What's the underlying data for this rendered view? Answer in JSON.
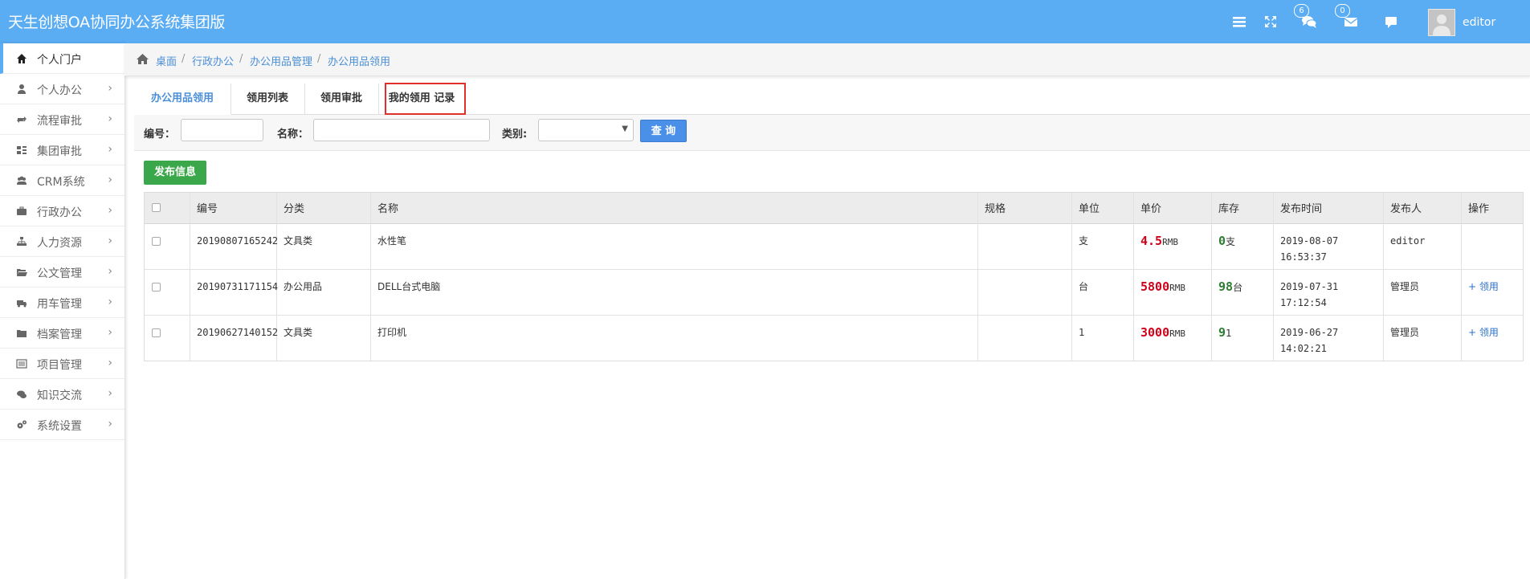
{
  "app": {
    "title": "天生创想OA协同办公系统集团版"
  },
  "topbar": {
    "icons": [
      "menu-icon",
      "fullscreen-icon",
      "chat-icon",
      "mail-icon",
      "comment-icon"
    ],
    "chat_badge": "6",
    "mail_badge": "0",
    "user_name": "editor"
  },
  "sidebar": {
    "items": [
      {
        "label": "个人门户",
        "icon": "home-icon"
      },
      {
        "label": "个人办公",
        "icon": "user-icon"
      },
      {
        "label": "流程审批",
        "icon": "workflow-icon"
      },
      {
        "label": "集团审批",
        "icon": "grid-icon"
      },
      {
        "label": "CRM系统",
        "icon": "users-icon"
      },
      {
        "label": "行政办公",
        "icon": "briefcase-icon"
      },
      {
        "label": "人力资源",
        "icon": "org-chart-icon"
      },
      {
        "label": "公文管理",
        "icon": "folder-open-icon"
      },
      {
        "label": "用车管理",
        "icon": "truck-icon"
      },
      {
        "label": "档案管理",
        "icon": "folder-icon"
      },
      {
        "label": "项目管理",
        "icon": "list-icon"
      },
      {
        "label": "知识交流",
        "icon": "comments-icon"
      },
      {
        "label": "系统设置",
        "icon": "cogs-icon"
      }
    ],
    "arrow": "›"
  },
  "breadcrumb": [
    "桌面",
    "行政办公",
    "办公用品管理",
    "办公用品领用"
  ],
  "tabs": [
    "办公用品领用",
    "领用列表",
    "领用审批",
    "我的领用 记录"
  ],
  "filters": {
    "code_label": "编号：",
    "name_label": "名称：",
    "category_label": "类别:",
    "query_button": "查 询"
  },
  "publish_button": "发布信息",
  "table": {
    "headers": [
      "编号",
      "分类",
      "名称",
      "规格",
      "单位",
      "单价",
      "库存",
      "发布时间",
      "发布人",
      "操作"
    ],
    "rows": [
      {
        "code": "20190807165242",
        "category": "文具类",
        "name": "水性笔",
        "spec": "",
        "unit": "支",
        "price": "4.5",
        "price_unit": "RMB",
        "stock": "0",
        "stock_unit": "支",
        "date": "2019-08-07",
        "time": "16:53:37",
        "publisher": "editor",
        "action": ""
      },
      {
        "code": "20190731171154",
        "category": "办公用品",
        "name": "DELL台式电脑",
        "spec": "",
        "unit": "台",
        "price": "5800",
        "price_unit": "RMB",
        "stock": "98",
        "stock_unit": "台",
        "date": "2019-07-31",
        "time": "17:12:54",
        "publisher": "管理员",
        "action": "+ 领用"
      },
      {
        "code": "20190627140152",
        "category": "文具类",
        "name": "打印机",
        "spec": "",
        "unit": "1",
        "price": "3000",
        "price_unit": "RMB",
        "stock": "9",
        "stock_unit": "1",
        "date": "2019-06-27",
        "time": "14:02:21",
        "publisher": "管理员",
        "action": "+ 领用"
      }
    ]
  },
  "colors": {
    "topbar": "#5aacf3",
    "link": "#4a8fd6",
    "price": "#d0021b",
    "stock": "#2e7d32",
    "publish": "#3aa84a",
    "query": "#4a8fe8",
    "highlight": "#e0302c"
  }
}
